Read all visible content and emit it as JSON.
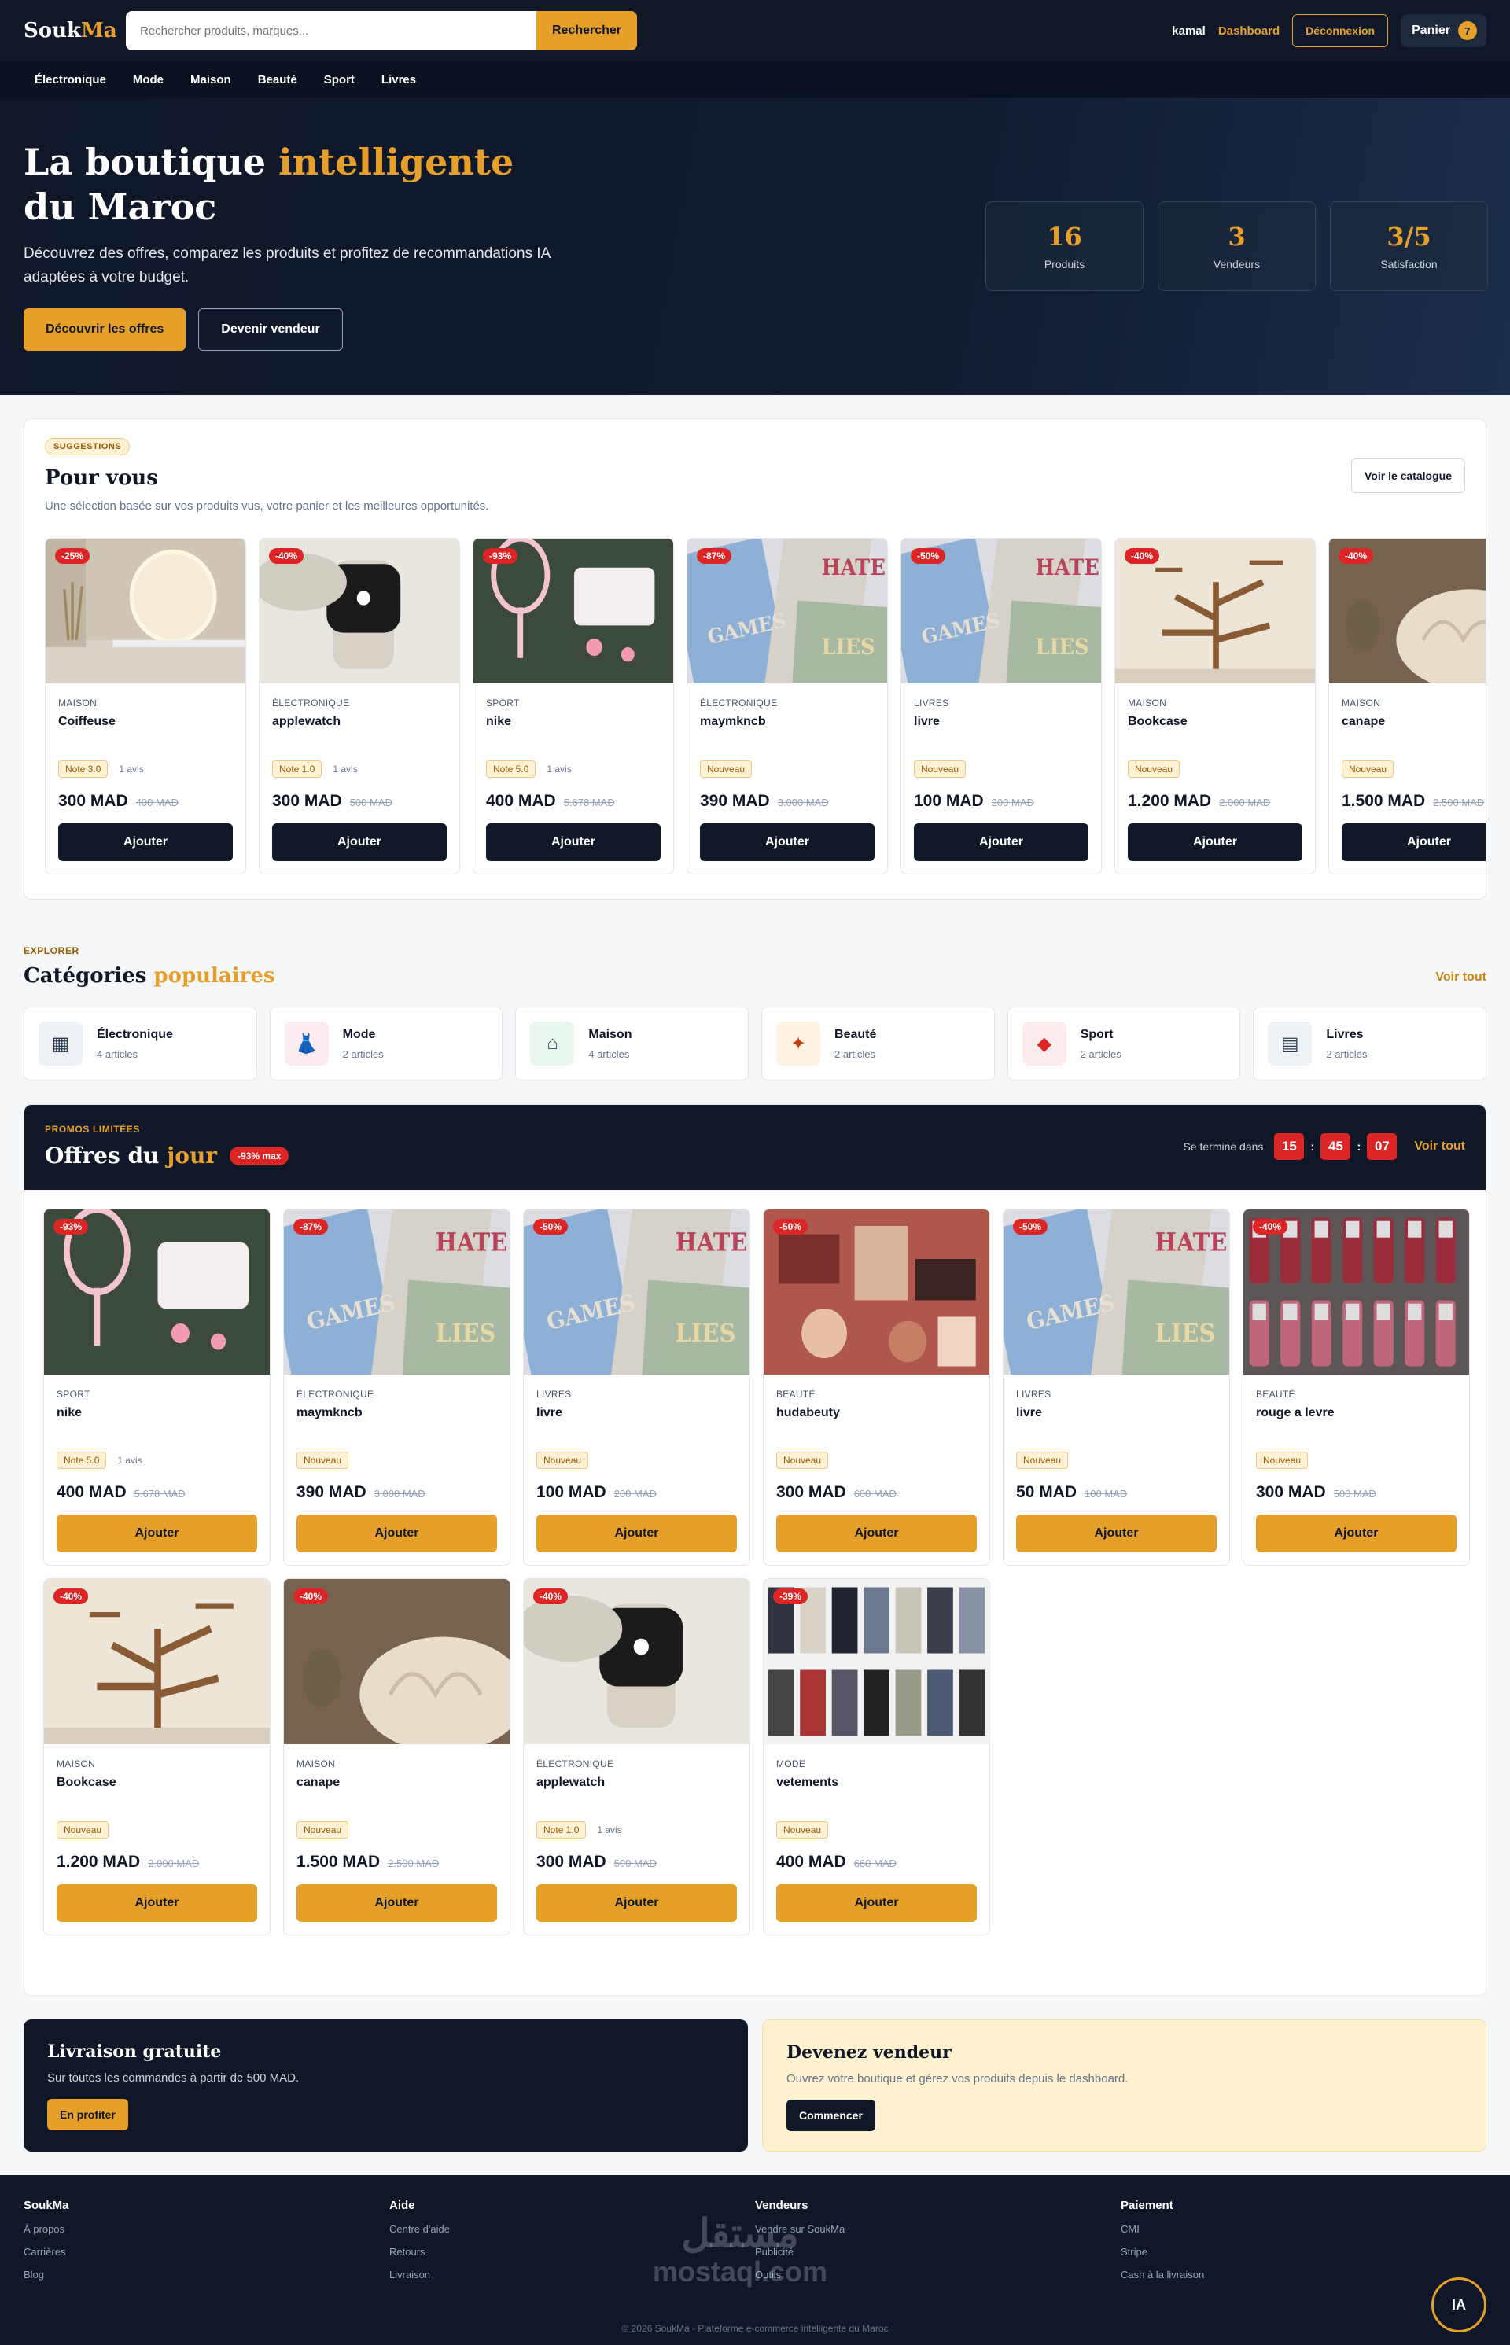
{
  "header": {
    "logo_a": "Souk",
    "logo_b": "Ma",
    "search_placeholder": "Rechercher produits, marques...",
    "search_button": "Rechercher",
    "user": "kamal",
    "dashboard": "Dashboard",
    "logout": "Déconnexion",
    "cart": "Panier",
    "cart_count": "7"
  },
  "nav": [
    "Électronique",
    "Mode",
    "Maison",
    "Beauté",
    "Sport",
    "Livres"
  ],
  "hero": {
    "title_a": "La boutique ",
    "title_b": "intelligente",
    "title_c": "du Maroc",
    "subtitle": "Découvrez des offres, comparez les produits et profitez de recommandations IA adaptées à votre budget.",
    "cta_primary": "Découvrir les offres",
    "cta_secondary": "Devenir vendeur",
    "stats": [
      {
        "value": "16",
        "label": "Produits"
      },
      {
        "value": "3",
        "label": "Vendeurs"
      },
      {
        "value": "3/5",
        "label": "Satisfaction"
      }
    ]
  },
  "suggestions": {
    "pill": "SUGGESTIONS",
    "title": "Pour vous",
    "subtitle": "Une sélection basée sur vos produits vus, votre panier et les meilleures opportunités.",
    "catalog_button": "Voir le catalogue",
    "add_label": "Ajouter",
    "items": [
      {
        "discount": "-25%",
        "category": "MAISON",
        "name": "Coiffeuse",
        "badge": "Note 3.0",
        "reviews": "1 avis",
        "price": "300 MAD",
        "old": "400 MAD",
        "img": "mirror"
      },
      {
        "discount": "-40%",
        "category": "ÉLECTRONIQUE",
        "name": "applewatch",
        "badge": "Note 1.0",
        "reviews": "1 avis",
        "price": "300 MAD",
        "old": "500 MAD",
        "img": "watch"
      },
      {
        "discount": "-93%",
        "category": "SPORT",
        "name": "nike",
        "badge": "Note 5.0",
        "reviews": "1 avis",
        "price": "400 MAD",
        "old": "5.678 MAD",
        "img": "racket"
      },
      {
        "discount": "-87%",
        "category": "ÉLECTRONIQUE",
        "name": "maymkncb",
        "badge": "Nouveau",
        "reviews": "",
        "price": "390 MAD",
        "old": "3.000 MAD",
        "img": "books"
      },
      {
        "discount": "-50%",
        "category": "LIVRES",
        "name": "livre",
        "badge": "Nouveau",
        "reviews": "",
        "price": "100 MAD",
        "old": "200 MAD",
        "img": "books"
      },
      {
        "discount": "-40%",
        "category": "MAISON",
        "name": "Bookcase",
        "badge": "Nouveau",
        "reviews": "",
        "price": "1.200 MAD",
        "old": "2.000 MAD",
        "img": "shelf"
      },
      {
        "discount": "-40%",
        "category": "MAISON",
        "name": "canape",
        "badge": "Nouveau",
        "reviews": "",
        "price": "1.500 MAD",
        "old": "2.500 MAD",
        "img": "sofa"
      }
    ]
  },
  "explore": {
    "eyebrow": "EXPLORER",
    "title_a": "Catégories ",
    "title_b": "populaires",
    "see_all": "Voir tout",
    "categories": [
      {
        "name": "Électronique",
        "count": "4 articles",
        "icon": "▦",
        "bg": "#eef1f5",
        "fg": "#334155"
      },
      {
        "name": "Mode",
        "count": "2 articles",
        "icon": "👗",
        "bg": "#fdecef",
        "fg": "#2563eb"
      },
      {
        "name": "Maison",
        "count": "4 articles",
        "icon": "⌂",
        "bg": "#eaf7ee",
        "fg": "#475569"
      },
      {
        "name": "Beauté",
        "count": "2 articles",
        "icon": "✦",
        "bg": "#fdf3e3",
        "fg": "#c2410c"
      },
      {
        "name": "Sport",
        "count": "2 articles",
        "icon": "◆",
        "bg": "#fdecee",
        "fg": "#dc2626"
      },
      {
        "name": "Livres",
        "count": "2 articles",
        "icon": "▤",
        "bg": "#eef3f8",
        "fg": "#334155"
      }
    ]
  },
  "promo": {
    "eyebrow": "PROMOS LIMITÉES",
    "title_a": "Offres du ",
    "title_b": "jour",
    "max_badge": "-93% max",
    "ends_in": "Se termine dans",
    "hh": "15",
    "mm": "45",
    "ss": "07",
    "see_all": "Voir tout",
    "add_label": "Ajouter",
    "items": [
      {
        "discount": "-93%",
        "category": "SPORT",
        "name": "nike",
        "badge": "Note 5.0",
        "reviews": "1 avis",
        "price": "400 MAD",
        "old": "5.678 MAD",
        "img": "racket"
      },
      {
        "discount": "-87%",
        "category": "ÉLECTRONIQUE",
        "name": "maymkncb",
        "badge": "Nouveau",
        "reviews": "",
        "price": "390 MAD",
        "old": "3.000 MAD",
        "img": "books"
      },
      {
        "discount": "-50%",
        "category": "LIVRES",
        "name": "livre",
        "badge": "Nouveau",
        "reviews": "",
        "price": "100 MAD",
        "old": "200 MAD",
        "img": "books"
      },
      {
        "discount": "-50%",
        "category": "BEAUTÉ",
        "name": "hudabeuty",
        "badge": "Nouveau",
        "reviews": "",
        "price": "300 MAD",
        "old": "600 MAD",
        "img": "makeup"
      },
      {
        "discount": "-50%",
        "category": "LIVRES",
        "name": "livre",
        "badge": "Nouveau",
        "reviews": "",
        "price": "50 MAD",
        "old": "100 MAD",
        "img": "books"
      },
      {
        "discount": "-40%",
        "category": "BEAUTÉ",
        "name": "rouge a levre",
        "badge": "Nouveau",
        "reviews": "",
        "price": "300 MAD",
        "old": "500 MAD",
        "img": "lipstick"
      },
      {
        "discount": "-40%",
        "category": "MAISON",
        "name": "Bookcase",
        "badge": "Nouveau",
        "reviews": "",
        "price": "1.200 MAD",
        "old": "2.000 MAD",
        "img": "shelf"
      },
      {
        "discount": "-40%",
        "category": "MAISON",
        "name": "canape",
        "badge": "Nouveau",
        "reviews": "",
        "price": "1.500 MAD",
        "old": "2.500 MAD",
        "img": "sofa"
      },
      {
        "discount": "-40%",
        "category": "ÉLECTRONIQUE",
        "name": "applewatch",
        "badge": "Note 1.0",
        "reviews": "1 avis",
        "price": "300 MAD",
        "old": "500 MAD",
        "img": "watch"
      },
      {
        "discount": "-39%",
        "category": "MODE",
        "name": "vetements",
        "badge": "Nouveau",
        "reviews": "",
        "price": "400 MAD",
        "old": "660 MAD",
        "img": "clothes"
      }
    ]
  },
  "banners": {
    "left_title": "Livraison gratuite",
    "left_text": "Sur toutes les commandes à partir de 500 MAD.",
    "left_button": "En profiter",
    "right_title": "Devenez vendeur",
    "right_text": "Ouvrez votre boutique et gérez vos produits depuis le dashboard.",
    "right_button": "Commencer"
  },
  "footer": {
    "columns": [
      {
        "title": "SoukMa",
        "links": [
          "À propos",
          "Carrières",
          "Blog"
        ]
      },
      {
        "title": "Aide",
        "links": [
          "Centre d'aide",
          "Retours",
          "Livraison"
        ]
      },
      {
        "title": "Vendeurs",
        "links": [
          "Vendre sur SoukMa",
          "Publicité",
          "Outils"
        ]
      },
      {
        "title": "Paiement",
        "links": [
          "CMI",
          "Stripe",
          "Cash à la livraison"
        ]
      }
    ],
    "copyright": "© 2026 SoukMa - Plateforme e-commerce intelligente du Maroc",
    "watermark_ar": "مستقل",
    "watermark_en": "mostaql.com",
    "ia_button": "IA"
  }
}
